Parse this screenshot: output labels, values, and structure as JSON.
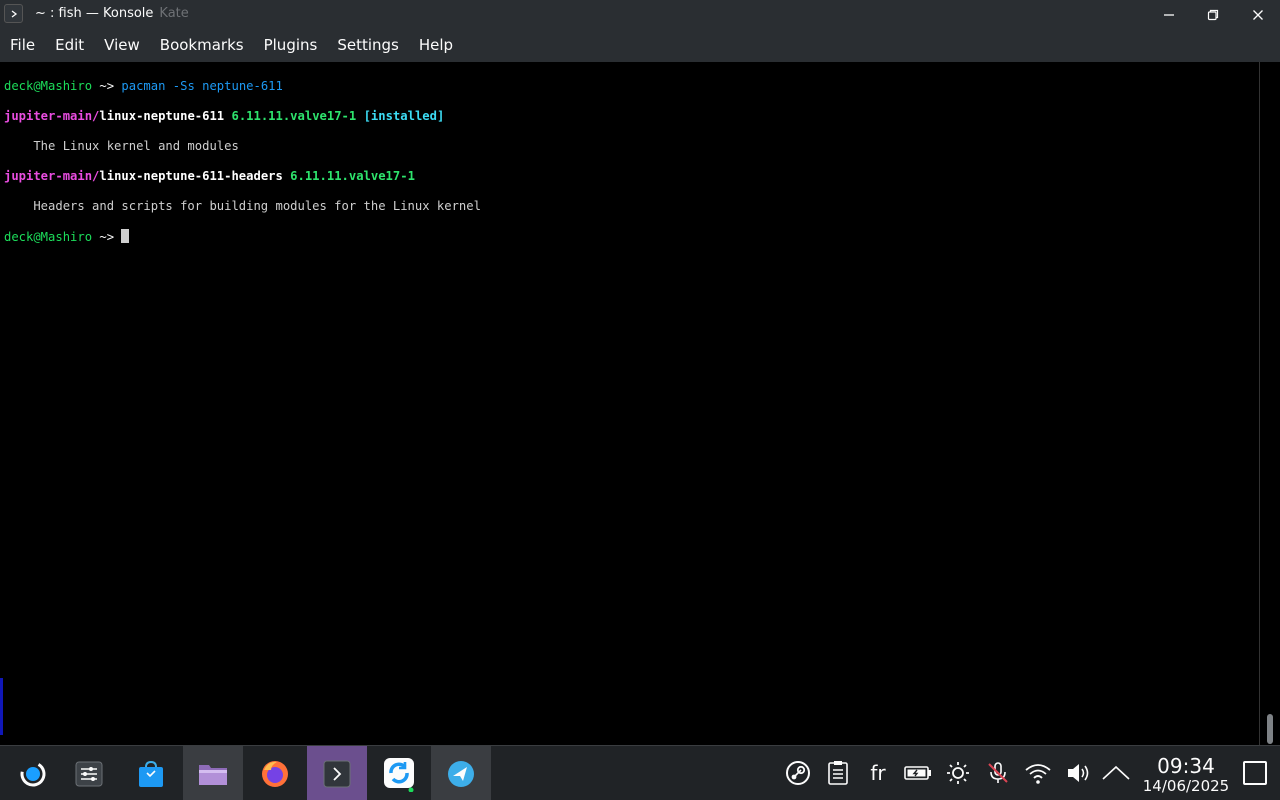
{
  "window": {
    "title_main": "~ : fish — Konsole",
    "title_inactive": "Kate"
  },
  "menu": [
    "File",
    "Edit",
    "View",
    "Bookmarks",
    "Plugins",
    "Settings",
    "Help"
  ],
  "terminal": {
    "prompt_user": "deck@Mashiro",
    "prompt_dir": " ~> ",
    "command": "pacman -Ss neptune-611",
    "results": [
      {
        "repo": "jupiter-main/",
        "name": "linux-neptune-611",
        "version": "6.11.11.valve17-1",
        "status": "[installed]",
        "desc": "    The Linux kernel and modules"
      },
      {
        "repo": "jupiter-main/",
        "name": "linux-neptune-611-headers",
        "version": "6.11.11.valve17-1",
        "status": "",
        "desc": "    Headers and scripts for building modules for the Linux kernel"
      }
    ]
  },
  "taskbar": {
    "apps": [
      "application-launcher-icon",
      "system-settings-icon",
      "discover-store-icon",
      "file-manager-icon",
      "firefox-icon",
      "konsole-icon",
      "sync-app-icon",
      "browser-app-icon"
    ],
    "tray": {
      "language": "fr"
    },
    "clock": {
      "time": "09:34",
      "date": "14/06/2025"
    }
  },
  "colors": {
    "prompt_green": "#1cdc5a",
    "command_blue": "#1d99f3",
    "repo_magenta": "#e94de0",
    "installed_cyan": "#3cdcf4",
    "titlebar_bg": "#2a2e32",
    "taskbar_bg": "#202326"
  }
}
